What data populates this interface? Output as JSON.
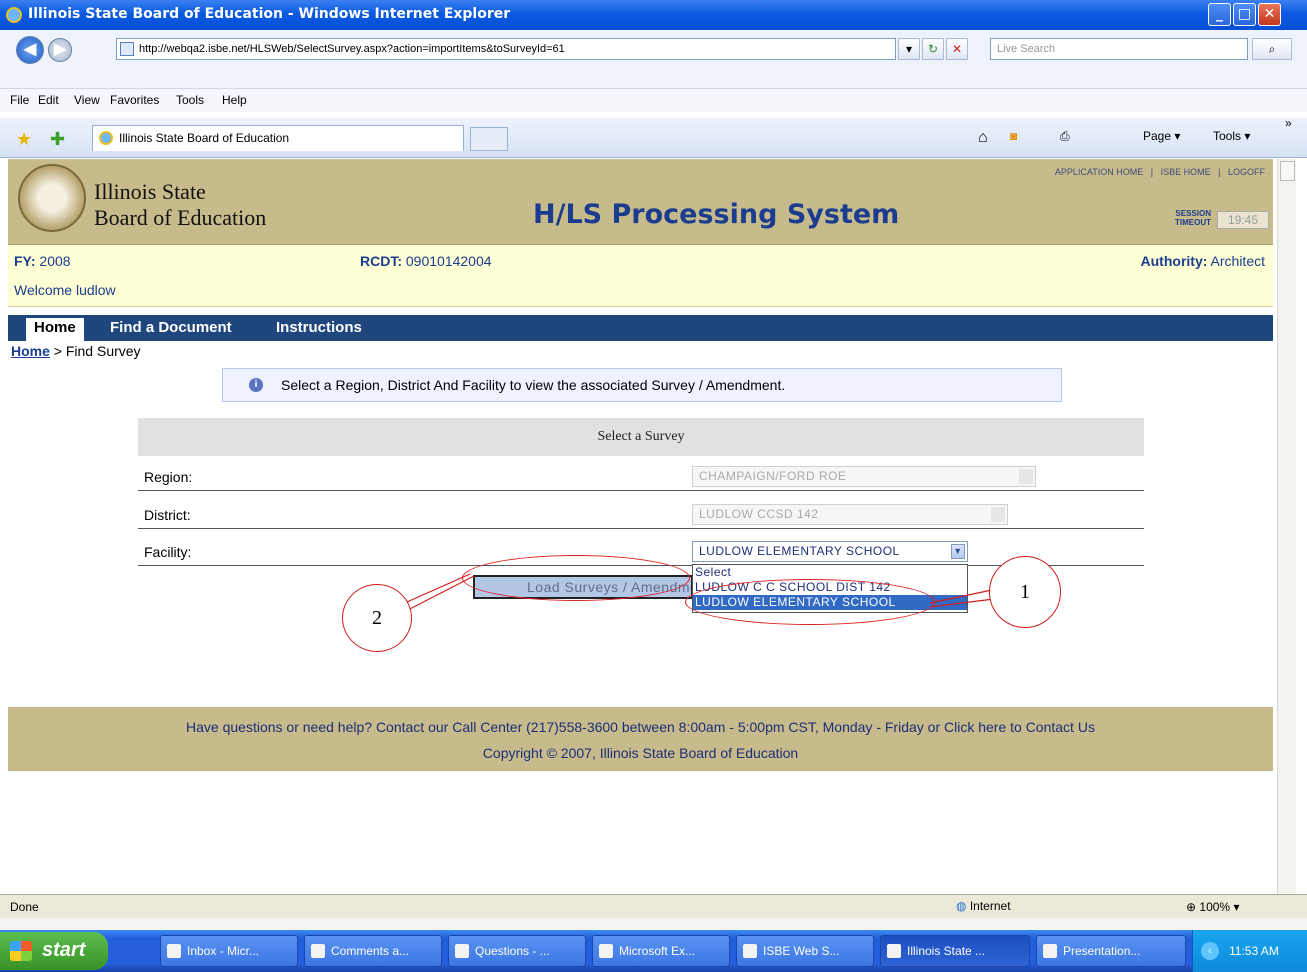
{
  "window": {
    "title": "Illinois State Board of Education - Windows Internet Explorer",
    "min": "_",
    "max": "□",
    "close": "✕"
  },
  "browser": {
    "back": "◀",
    "forward": "▶",
    "address": "http://webqa2.isbe.net/HLSWeb/SelectSurvey.aspx?action=importItems&toSurveyId=61",
    "search_placeholder": "Live Search",
    "menu": [
      "File",
      "Edit",
      "View",
      "Favorites",
      "Tools",
      "Help"
    ],
    "tab_title": "Illinois State Board of Education",
    "cmd_page": "Page ▾",
    "cmd_tools": "Tools ▾",
    "more": "»"
  },
  "header": {
    "org_line1": "Illinois State",
    "org_line2": "Board of Education",
    "system_title": "H/LS Processing System",
    "link_app_home": "APPLICATION HOME",
    "link_isbe_home": "ISBE HOME",
    "link_logoff": "LOGOFF",
    "sep": "|",
    "session_line1": "SESSION",
    "session_line2": "TIMEOUT",
    "session_timer": "19:45"
  },
  "info": {
    "fy_label": "FY:",
    "fy_value": "2008",
    "rcdt_label": "RCDT:",
    "rcdt_value": "09010142004",
    "authority_label": "Authority:",
    "authority_value": "Architect",
    "welcome": "Welcome ludlow"
  },
  "nav": {
    "items": [
      "Home",
      "Find a Document",
      "Instructions"
    ]
  },
  "breadcrumb": {
    "home": "Home",
    "current": " > Find Survey"
  },
  "notice": {
    "icon": "i",
    "text": "Select a Region, District And Facility to view the associated Survey / Amendment."
  },
  "form": {
    "title": "Select a Survey",
    "region_label": "Region:",
    "region_value": "CHAMPAIGN/FORD ROE",
    "district_label": "District:",
    "district_value": "LUDLOW CCSD 142",
    "facility_label": "Facility:",
    "facility_value": "LUDLOW ELEMENTARY SCHOOL",
    "facility_options": [
      "Select",
      "LUDLOW C C SCHOOL DIST 142",
      "LUDLOW ELEMENTARY SCHOOL"
    ],
    "facility_highlighted_index": 2,
    "load_button": "Load Surveys / Amendments"
  },
  "annotations": {
    "callout1": "1",
    "callout2": "2"
  },
  "footer": {
    "line1": "Have questions or need help? Contact our Call Center (217)558-3600 between 8:00am - 5:00pm CST, Monday - Friday or Click here to Contact Us",
    "line2": "Copyright © 2007, Illinois State Board of Education"
  },
  "status": {
    "text": "Done",
    "zone": "Internet",
    "zoom": "100%"
  },
  "taskbar": {
    "start": "start",
    "tasks": [
      "Inbox - Micr...",
      "Comments a...",
      "Questions - ...",
      "Microsoft Ex...",
      "ISBE Web S...",
      "Illinois State ...",
      "Presentation..."
    ],
    "active_index": 5,
    "clock": "11:53 AM"
  }
}
